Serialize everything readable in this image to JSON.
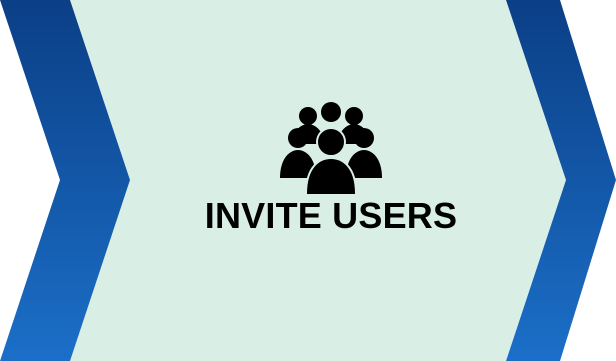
{
  "step": {
    "label": "INVITE USERS",
    "icon": "users-group-icon"
  },
  "colors": {
    "panel": "#d9efe6",
    "chevron_dark": "#0b3f86",
    "chevron_light": "#1b6fc8"
  }
}
